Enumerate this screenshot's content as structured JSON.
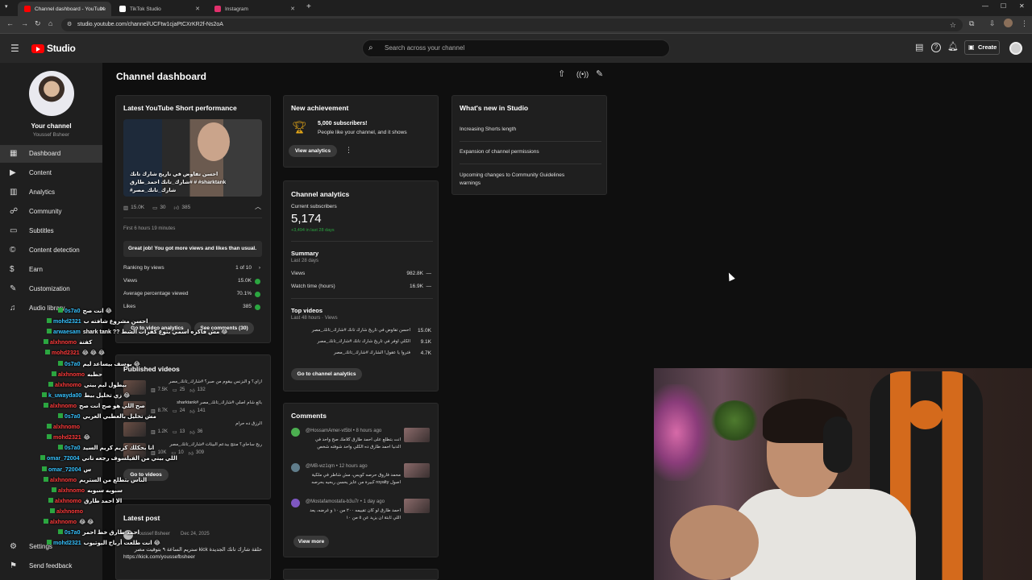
{
  "browser": {
    "tabs": [
      {
        "title": "Channel dashboard - YouTube",
        "active": true,
        "color": "#ff0000"
      },
      {
        "title": "TikTok Studio",
        "active": false,
        "color": "#ffffff"
      },
      {
        "title": "Instagram",
        "active": false,
        "color": "#e1306c"
      }
    ],
    "new_tab": "+",
    "url": "studio.youtube.com/channel/UCFtw1cjaPtCXrKR2f-Ns2oA"
  },
  "header": {
    "logo_text": "Studio",
    "search_placeholder": "Search across your channel",
    "create_label": "Create"
  },
  "sidebar": {
    "channel_label": "Your channel",
    "channel_name": "Youssef Bsheer",
    "items": [
      {
        "label": "Dashboard",
        "icon": "dashboard-icon",
        "active": true
      },
      {
        "label": "Content",
        "icon": "content-icon"
      },
      {
        "label": "Analytics",
        "icon": "analytics-icon"
      },
      {
        "label": "Community",
        "icon": "community-icon"
      },
      {
        "label": "Subtitles",
        "icon": "subtitles-icon"
      },
      {
        "label": "Content detection",
        "icon": "copyright-icon"
      },
      {
        "label": "Earn",
        "icon": "earn-icon"
      },
      {
        "label": "Customization",
        "icon": "customization-icon"
      },
      {
        "label": "Audio library",
        "icon": "audio-library-icon"
      }
    ],
    "settings_label": "Settings",
    "feedback_label": "Send feedback"
  },
  "page_title": "Channel dashboard",
  "short_card": {
    "title": "Latest YouTube Short performance",
    "thumb_caption": "احسن تفاوض في تاريخ شارك تانك #شارك_تانك احمد_طارق # #sharktank #شارك_تانك_مصر",
    "views": "15.0K",
    "comments": "30",
    "likes": "385",
    "period": "First 6 hours 19 minutes",
    "banner": "Great job! You got more views and likes than usual.",
    "rows": [
      {
        "label": "Ranking by views",
        "value": "1 of 10"
      },
      {
        "label": "Views",
        "value": "15.0K"
      },
      {
        "label": "Average percentage viewed",
        "value": "70.1%"
      },
      {
        "label": "Likes",
        "value": "385"
      }
    ],
    "btn_analytics": "Go to video analytics",
    "btn_comments": "See comments (30)"
  },
  "published": {
    "title": "Published videos",
    "videos": [
      {
        "title": "ازاي؟ و البزنس بيقوم من صبر؟ #شارك_تانك_مصر",
        "views": "7.5K",
        "comments": "25",
        "likes": "132"
      },
      {
        "title": "بائع شام اصلي #شارك_تانك_مصر #sharktank",
        "views": "8.7K",
        "comments": "24",
        "likes": "141"
      },
      {
        "title": "الرزق ده حرام",
        "views": "1.2K",
        "comments": "13",
        "likes": "36"
      },
      {
        "title": "ربح ساحاي؟ منتج بيدعم البيئات #شارك_تانك_مصر",
        "views": "10K",
        "comments": "10",
        "likes": "309"
      }
    ],
    "btn": "Go to videos"
  },
  "latest_post": {
    "title": "Latest post",
    "author": "Youssef Bsheer",
    "date": "Dec 24, 2025",
    "text": "حلقة شارك تانك الجديدة kick ستريم الساعة ٩ بتوقيت مصر",
    "link": "https://kick.com/youssefbsheer"
  },
  "achievement": {
    "title": "New achievement",
    "headline": "5,000 subscribers!",
    "sub": "People like your channel, and it shows",
    "btn": "View analytics"
  },
  "analytics": {
    "title": "Channel analytics",
    "subs_label": "Current subscribers",
    "subs_value": "5,174",
    "subs_change": "+3,494 in last 28 days",
    "summary_title": "Summary",
    "summary_period": "Last 28 days",
    "summary": [
      {
        "label": "Views",
        "value": "982.8K"
      },
      {
        "label": "Watch time (hours)",
        "value": "16.9K"
      }
    ],
    "top_title": "Top videos",
    "top_period": "Last 48 hours · Views",
    "top": [
      {
        "title": "احسن تفاوض في تاريخ شارك تانك #شارك_تانك_مصر",
        "value": "15.0K"
      },
      {
        "title": "الكلي اوفر في تاريخ شارك تانك #شارك_تانك_مصر",
        "value": "9.1K"
      },
      {
        "title": "فتروا يا عقول! الشارك #شارك_تانك_مصر",
        "value": "4.7K"
      }
    ],
    "btn": "Go to channel analytics"
  },
  "comments": {
    "title": "Comments",
    "items": [
      {
        "user": "@HossamAmer-vt5bl",
        "time": "8 hours ago",
        "text": "انت بتطلع على احمد طارق كلامك صح واحد في الدنيا احمد طارق ده الكلي واحد شوفته شخص",
        "avatar": "#4caf50"
      },
      {
        "user": "@MB-wz1qm",
        "time": "12 hours ago",
        "text": "محمد فاروق حرصه كويس، مش شاطر في ملكية اصول royalty كبيرة من عايز يحسن ربحيه بحرصه",
        "avatar": "#607d8b"
      },
      {
        "user": "@Mostafamostafa-b3u7r",
        "time": "1 day ago",
        "text": "احمد طارق لو كان تقييمه ٢٠٠ من ١٠ و غرضه، يعد اللي ثابتة ان يزيد عن ٥ من ١٠",
        "avatar": "#7e57c2"
      }
    ],
    "btn": "View more"
  },
  "whats_new": {
    "title": "What's new in Studio",
    "items": [
      "Increasing Shorts length",
      "Expansion of channel permissions",
      "Upcoming changes to Community Guidelines warnings"
    ]
  },
  "chat": [
    {
      "user": "0s7a0",
      "msg": "انت صح 😂",
      "red": false
    },
    {
      "user": "mohd2321",
      "msg": "احسن مشروع شافته ب",
      "red": false
    },
    {
      "user": "arwaesam",
      "msg": "shark tank ?? مش فاكره اسمي بتوع كفرات الشط 😂",
      "red": false
    },
    {
      "user": "alxhnomo",
      "msg": "كفتة",
      "red": true
    },
    {
      "user": "mohd2321",
      "msg": "😂 😂 😂",
      "red": true
    },
    {
      "user": "0s7a0",
      "msg": "يوسف بيساعد ليم 😂",
      "red": false
    },
    {
      "user": "alxhnomo",
      "msg": "حطبه",
      "red": true
    },
    {
      "user": "alxhnomo",
      "msg": "بيطول ليم بيني",
      "red": true
    },
    {
      "user": "k_uwayda00",
      "msg": "زي تخليل بيط 😂",
      "red": false
    },
    {
      "user": "alxhnomo",
      "msg": "صح اللي هو صح انت صح",
      "red": true
    },
    {
      "user": "0s7a0",
      "msg": "مش تخليل بالعطبي العربي",
      "red": false
    },
    {
      "user": "alxhnomo",
      "msg": "",
      "red": true
    },
    {
      "user": "mohd2321",
      "msg": "😂",
      "red": true
    },
    {
      "user": "0s7a0",
      "msg": "انا بحكلك كريم كريم السيد",
      "red": false
    },
    {
      "user": "omar_72004",
      "msg": "اللي بيني من الفيلسوف رجعه تاني",
      "red": false
    },
    {
      "user": "omar_72004",
      "msg": "س",
      "red": false
    },
    {
      "user": "alxhnomo",
      "msg": "الناس بتطلع من الستريم",
      "red": true
    },
    {
      "user": "alxhnomo",
      "msg": "سبوبه سبوبه",
      "red": true
    },
    {
      "user": "alxhnomo",
      "msg": "الا احمد طارق",
      "red": true
    },
    {
      "user": "alxhnomo",
      "msg": "",
      "red": true
    },
    {
      "user": "alxhnomo",
      "msg": "😂 😂",
      "red": true
    },
    {
      "user": "0s7a0",
      "msg": "احمد طارق خط احمر",
      "red": false
    },
    {
      "user": "mohd2321",
      "msg": "انت طلعت أرباح اليوتيوب 😂",
      "red": false
    }
  ]
}
